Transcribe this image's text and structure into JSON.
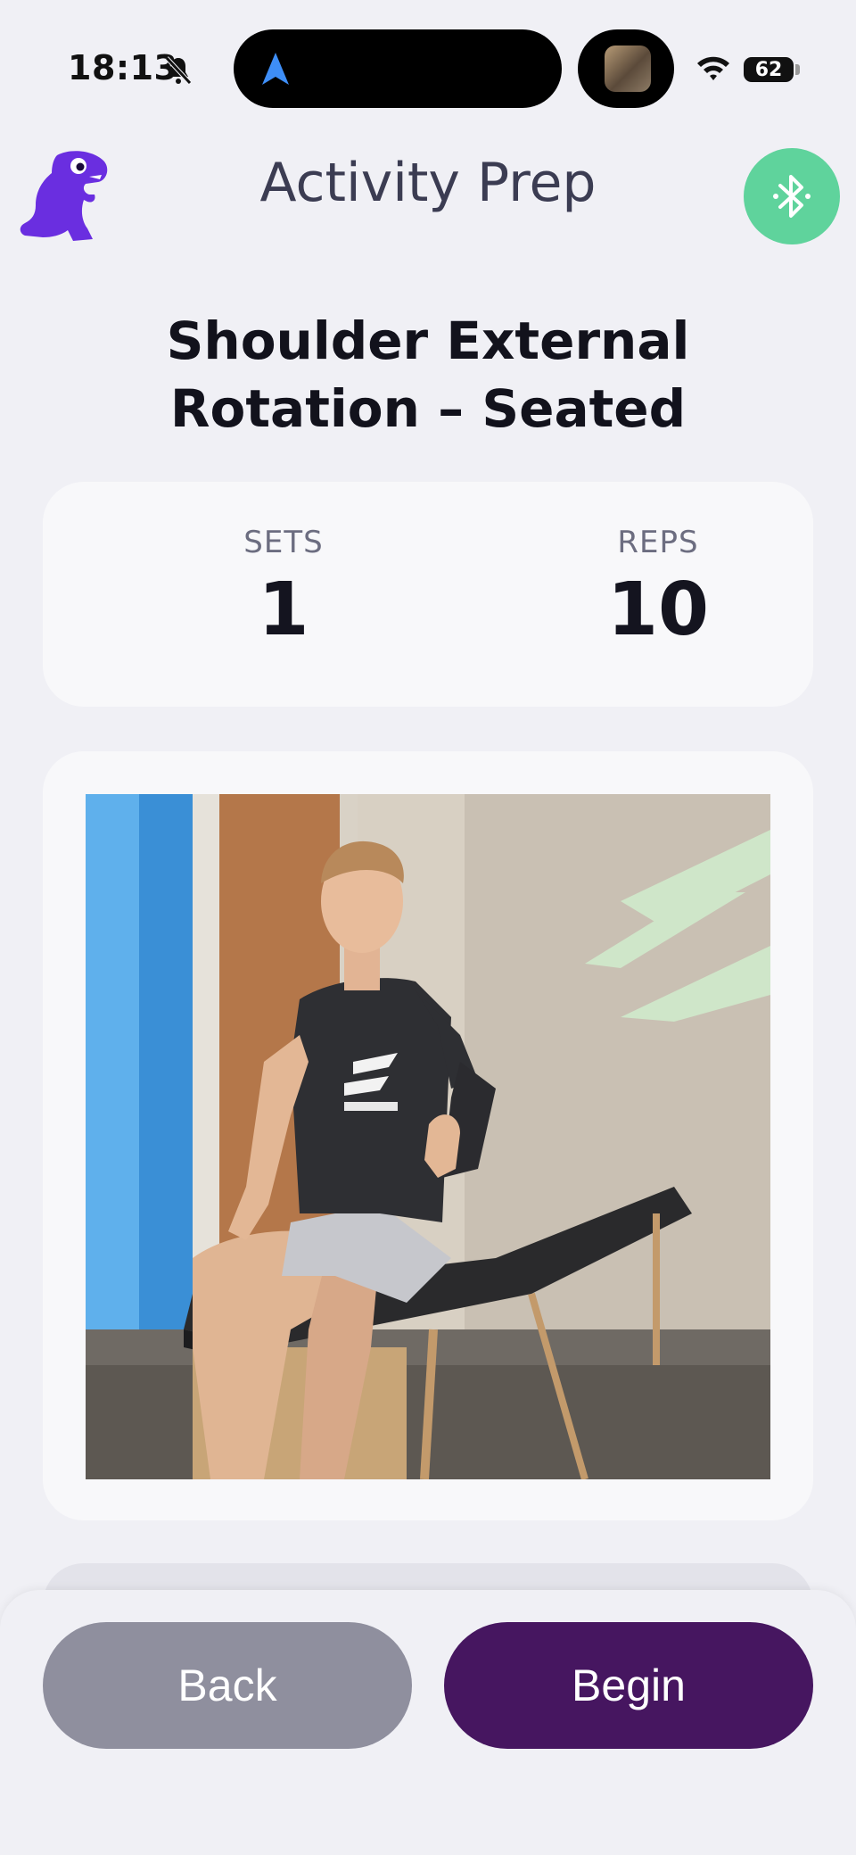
{
  "status_bar": {
    "time": "18:13",
    "battery": "62",
    "icons": [
      "bell-slash-icon",
      "navigation-arrow-icon",
      "wifi-icon",
      "battery-icon"
    ]
  },
  "header": {
    "title": "Activity Prep",
    "logo_icon": "dinosaur-logo-icon",
    "bluetooth_icon": "bluetooth-icon",
    "bluetooth_color": "#5fd39c"
  },
  "exercise": {
    "title": "Shoulder External Rotation – Seated",
    "sets_label": "SETS",
    "sets_value": "1",
    "reps_label": "REPS",
    "reps_value": "10"
  },
  "video": {
    "description_icon": "exercise-video-thumbnail"
  },
  "actions": {
    "back_label": "Back",
    "begin_label": "Begin",
    "begin_color": "#461660",
    "back_color": "#8f8f9e"
  },
  "colors": {
    "background": "#f0f0f5",
    "brand_purple": "#6a2ee0"
  }
}
